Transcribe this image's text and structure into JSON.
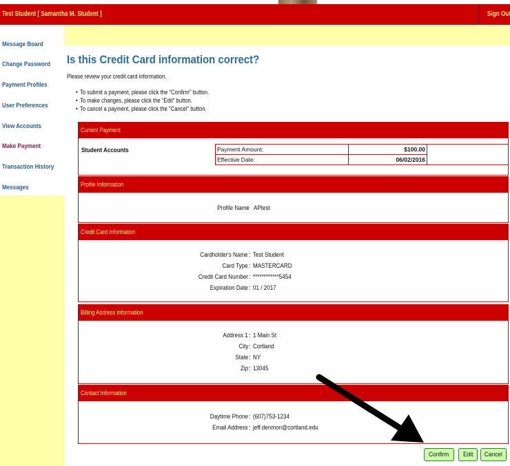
{
  "header": {
    "user": "Test Student  [ Samantha M. Student ]",
    "sign_out": "Sign Out"
  },
  "sidebar": {
    "items": [
      {
        "label": "Message Board"
      },
      {
        "label": "Change Password"
      },
      {
        "label": "Payment Profiles"
      },
      {
        "label": "User Preferences"
      },
      {
        "label": "View Accounts"
      },
      {
        "label": "Make Payment"
      },
      {
        "label": "Transaction History"
      },
      {
        "label": "Messages"
      }
    ]
  },
  "page": {
    "title": "Is this Credit Card information correct?",
    "intro": "Please review your credit card information.",
    "bullets": [
      "To submit a payment, please click the \"Confirm\" button.",
      "To make changes, please click the \"Edit\" button.",
      "To cancel a payment, please click the \"Cancel\" button."
    ]
  },
  "current_payment": {
    "header": "Current Payment",
    "account_label": "Student Accounts",
    "rows": [
      {
        "label": "Payment Amount:",
        "value": "$100.00"
      },
      {
        "label": "Effective Date:",
        "value": "06/02/2016"
      }
    ]
  },
  "profile": {
    "header": "Profile Information",
    "name_label": "Profile Name",
    "name_value": "APtest"
  },
  "credit_card": {
    "header": "Credit Card Information",
    "fields": [
      {
        "label": "Cardholder's Name",
        "value": "Test Student"
      },
      {
        "label": "Card Type",
        "value": "MASTERCARD"
      },
      {
        "label": "Credit Card Number",
        "value": "************5454"
      },
      {
        "label": "Expiration Date",
        "value": "01 / 2017"
      }
    ]
  },
  "billing": {
    "header": "Billing Address Information",
    "fields": [
      {
        "label": "Address 1",
        "value": "1 Main St"
      },
      {
        "label": "City",
        "value": "Cortland"
      },
      {
        "label": "State",
        "value": "NY"
      },
      {
        "label": "Zip",
        "value": "13045"
      }
    ]
  },
  "contact": {
    "header": "Contact Information",
    "fields": [
      {
        "label": "Daytime Phone",
        "value": "(607)753-1234"
      },
      {
        "label": "Email Address",
        "value": "jeff.denmon@cortland.edu"
      }
    ]
  },
  "buttons": {
    "confirm": "Confirm",
    "edit": "Edit",
    "cancel": "Cancel"
  },
  "colors": {
    "accent_red": "#cc0000",
    "header_text": "#ffe680",
    "sidebar_bg": "#ffffaa",
    "button_bg": "#ccffaa"
  }
}
